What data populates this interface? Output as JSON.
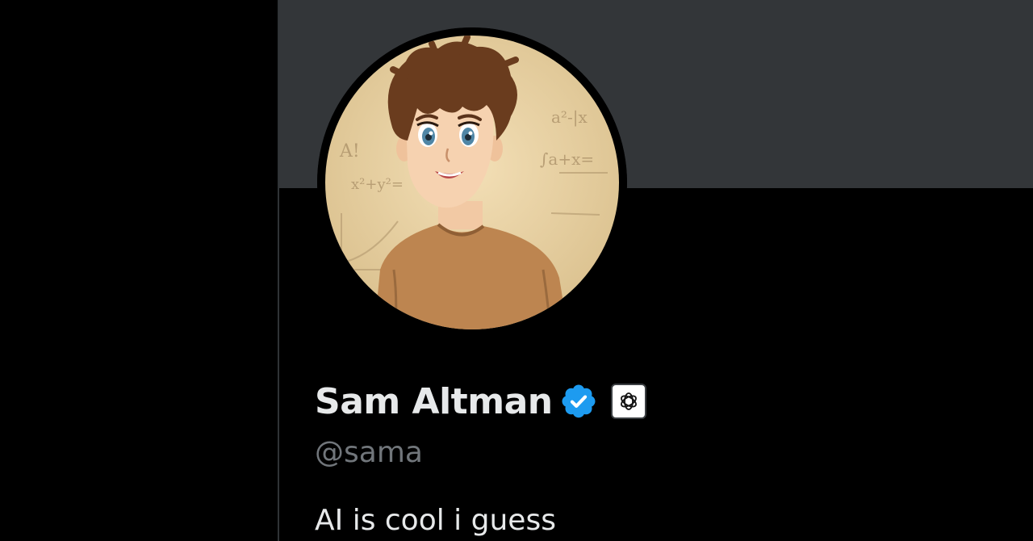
{
  "profile": {
    "display_name": "Sam Altman",
    "handle": "@sama",
    "bio": "AI is cool i guess",
    "verified_badge": "verified-checkmark-icon",
    "affiliation_badge": "openai-logo-icon",
    "avatar_alt": "anime-style-portrait"
  },
  "colors": {
    "background": "#000000",
    "banner": "#333639",
    "name_text": "#e7e9ea",
    "handle_text": "#71767b",
    "verified_blue": "#1d9bf0",
    "divider": "#2f3336"
  }
}
